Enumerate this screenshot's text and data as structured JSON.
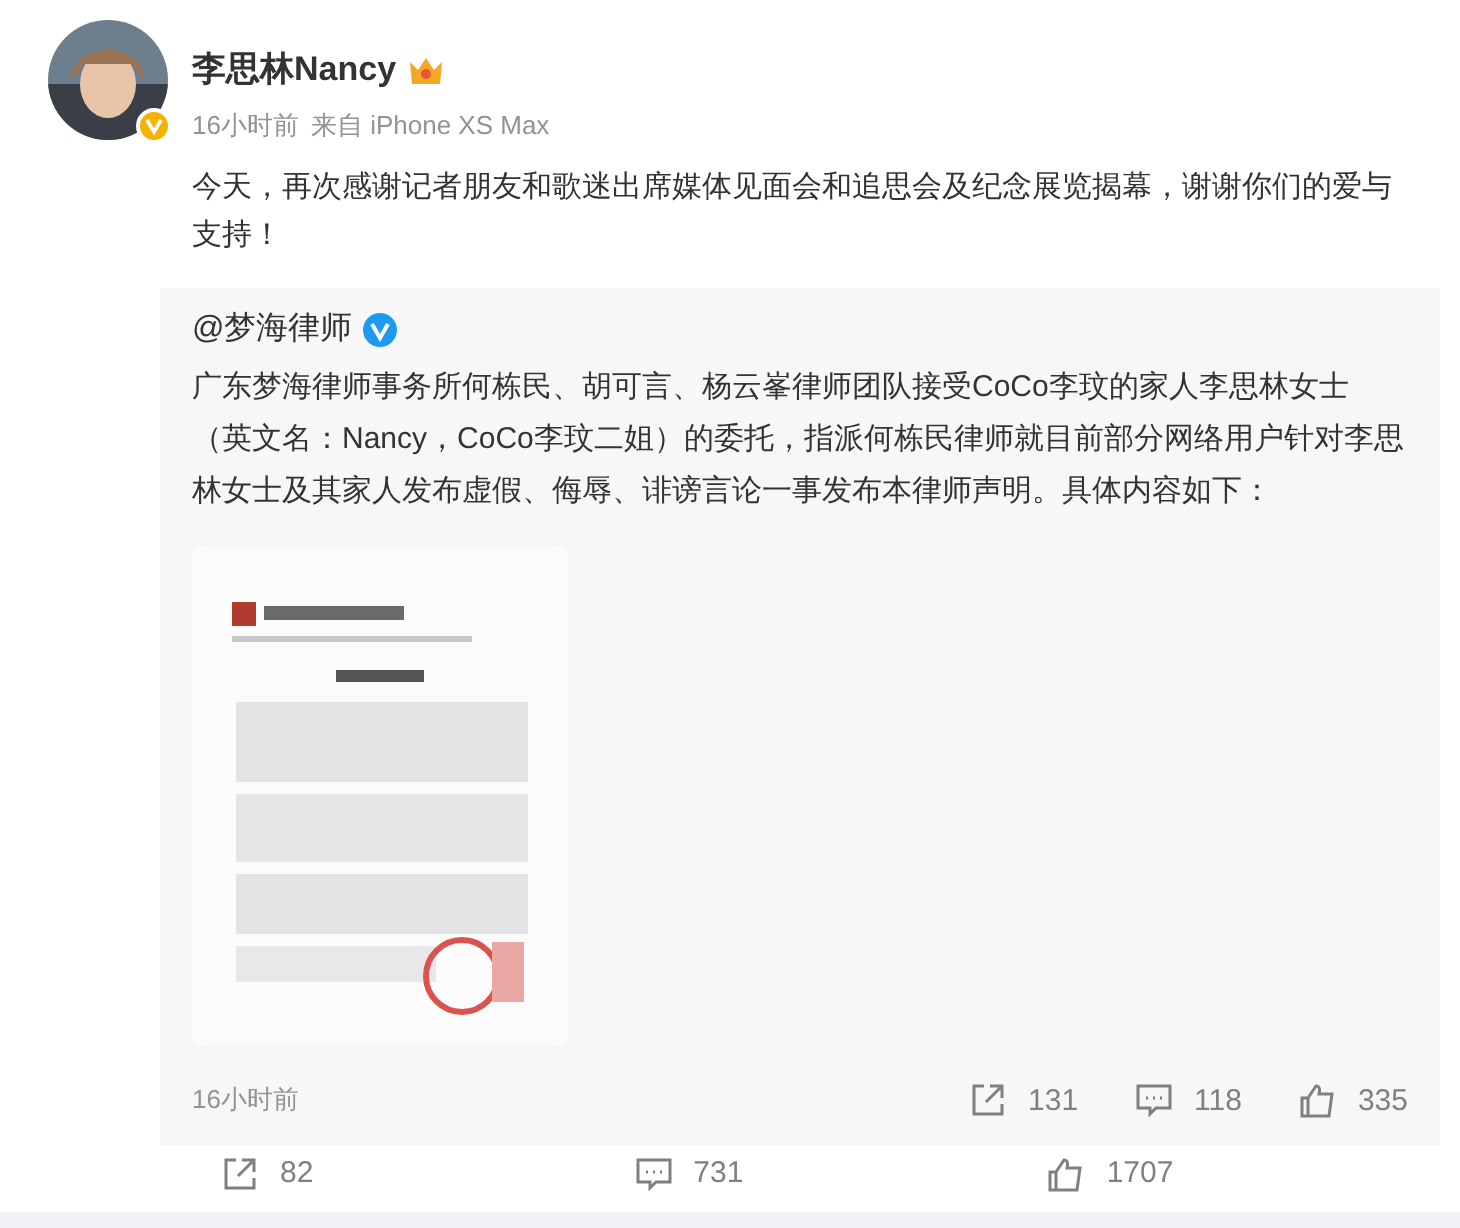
{
  "post": {
    "author": {
      "name": "李思林Nancy",
      "verified": true,
      "vip": true
    },
    "time": "16小时前",
    "source": "来自 iPhone XS Max",
    "text": "今天，再次感谢记者朋友和歌迷出席媒体见面会和追思会及纪念展览揭幕，谢谢你们的爱与支持！"
  },
  "repost": {
    "author": {
      "name": "@梦海律师",
      "verified": true
    },
    "text": "广东梦海律师事务所何栋民、胡可言、杨云峯律师团队接受CoCo李玟的家人李思林女士（英文名：Nancy，CoCo李玟二姐）的委托，指派何栋民律师就目前部分网络用户针对李思林女士及其家人发布虚假、侮辱、诽谤言论一事发布本律师声明。具体内容如下：",
    "time": "16小时前",
    "actions": [
      {
        "kind": "repost",
        "count": "131"
      },
      {
        "kind": "comment",
        "count": "118"
      },
      {
        "kind": "like",
        "count": "335"
      }
    ]
  },
  "actions": [
    {
      "kind": "repost",
      "count": "82"
    },
    {
      "kind": "comment",
      "count": "731"
    },
    {
      "kind": "like",
      "count": "1707"
    }
  ]
}
